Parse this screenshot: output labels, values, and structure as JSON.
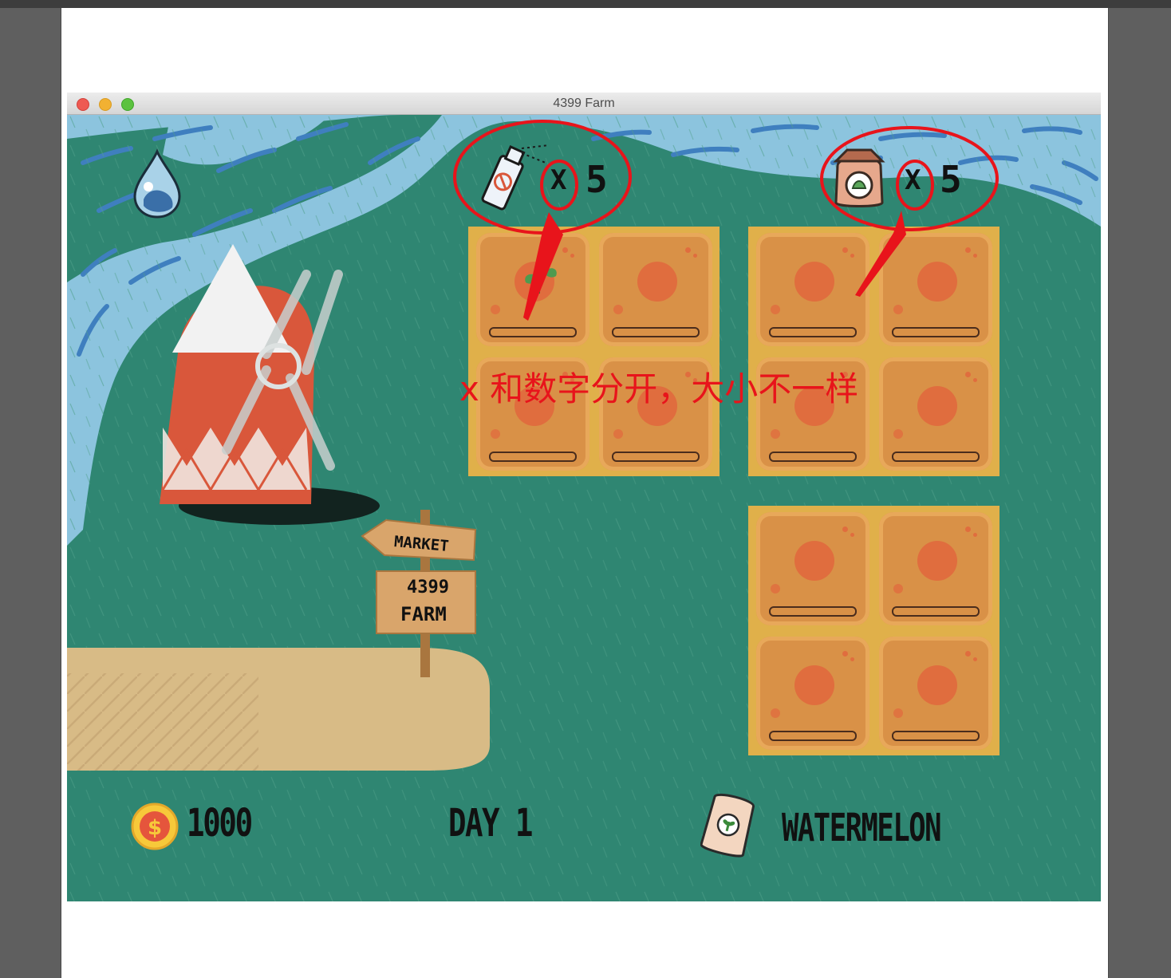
{
  "window": {
    "title": "4399 Farm"
  },
  "hud": {
    "pesticide": {
      "icon": "pesticide-spray-icon",
      "x_label": "X",
      "count": "5"
    },
    "fertilizer": {
      "icon": "fertilizer-bag-icon",
      "x_label": "X",
      "count": "5"
    },
    "water": {
      "icon": "water-drop-icon"
    }
  },
  "status_bar": {
    "coins": {
      "icon": "coin-dollar-icon",
      "value": "1000"
    },
    "day": "DAY 1",
    "seed": {
      "icon": "seed-bag-icon",
      "name": "WATERMELON"
    }
  },
  "signpost": {
    "top": "MARKET",
    "line1": "4399",
    "line2": "FARM"
  },
  "annotation": {
    "text": "x 和数字分开，大小不一样",
    "color": "#e8141b"
  },
  "colors": {
    "grass": "#2f8672",
    "river": "#8cc4de",
    "soil": "#d99147",
    "plot_border": "#e0b04a",
    "path": "#d8bb86"
  }
}
